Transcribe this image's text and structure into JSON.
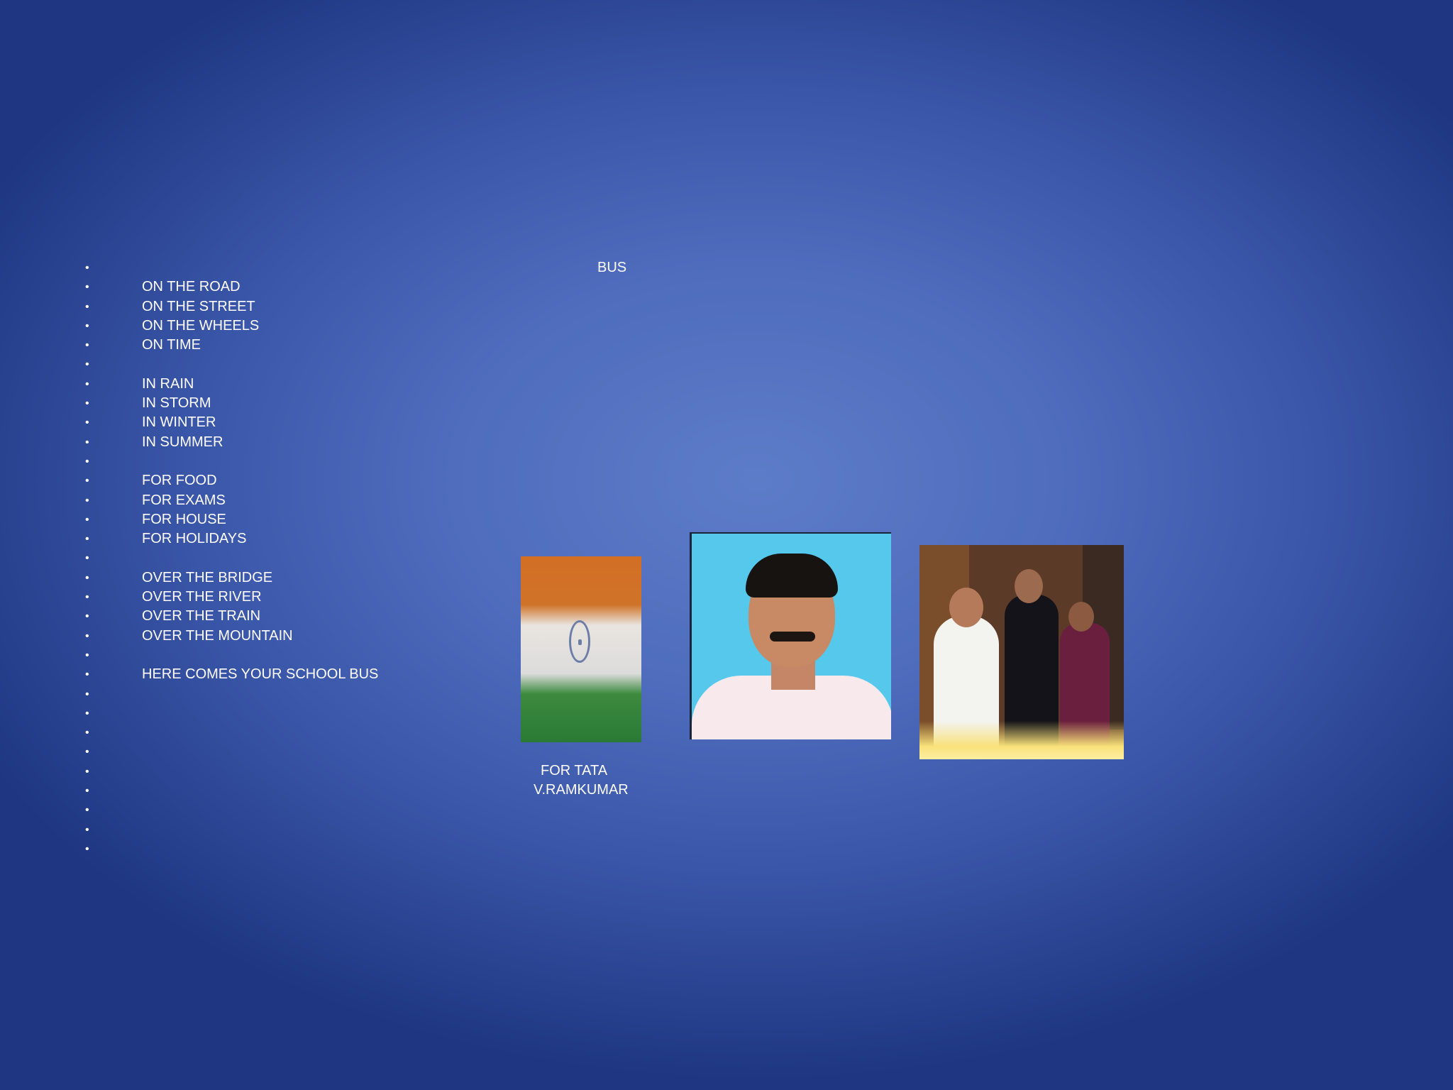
{
  "slide": {
    "title": "BUS",
    "lines": [
      "",
      "ON THE ROAD",
      "ON THE STREET",
      "ON THE WHEELS",
      "ON TIME",
      "",
      "IN RAIN",
      "IN STORM",
      "IN WINTER",
      "IN SUMMER",
      "",
      "FOR FOOD",
      "FOR EXAMS",
      "FOR HOUSE",
      "FOR HOLIDAYS",
      "",
      "OVER THE BRIDGE",
      "OVER THE RIVER",
      "OVER THE TRAIN",
      "OVER THE MOUNTAIN",
      "",
      "HERE COMES YOUR SCHOOL BUS",
      "",
      "",
      "",
      "",
      "",
      "",
      "",
      "",
      ""
    ],
    "bullet": "•",
    "caption_company": "FOR TATA",
    "caption_author": "V.RAMKUMAR"
  },
  "colors": {
    "background_center": "#5d7cc8",
    "background_edge": "#1f3782",
    "text": "#ffffff"
  },
  "images": {
    "flag": "indian-flag",
    "portrait": "man-portrait",
    "group": "group-photo"
  }
}
